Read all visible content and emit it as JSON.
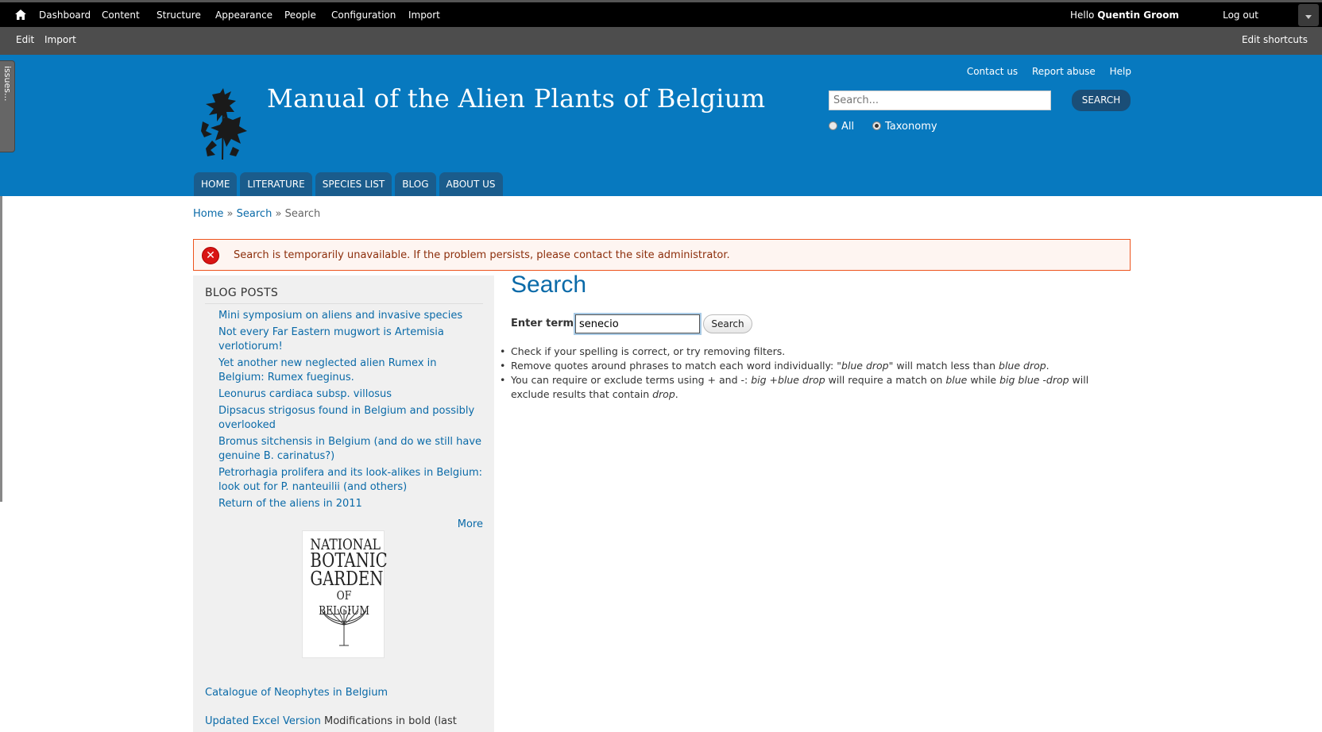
{
  "admin_toolbar": {
    "items": [
      "Dashboard",
      "Content",
      "Structure",
      "Appearance",
      "People",
      "Configuration",
      "Import"
    ],
    "greeting": "Hello",
    "username": "Quentin Groom",
    "logout": "Log out"
  },
  "shortcuts": {
    "items": [
      "Edit",
      "Import"
    ],
    "edit_shortcuts": "Edit shortcuts"
  },
  "side_tab": "issues...",
  "header": {
    "site_name": "Manual of the Alien Plants of Belgium",
    "secondary_links": [
      "Contact us",
      "Report abuse",
      "Help"
    ],
    "search_placeholder": "Search...",
    "search_button": "SEARCH",
    "radio_all": "All",
    "radio_taxonomy": "Taxonomy",
    "selected_radio": "Taxonomy"
  },
  "main_menu": [
    "HOME",
    "LITERATURE",
    "SPECIES LIST",
    "BLOG",
    "ABOUT US"
  ],
  "breadcrumb": {
    "home": "Home",
    "sep": "»",
    "search_link": "Search",
    "current": "Search"
  },
  "message": {
    "text": "Search is temporarily unavailable. If the problem persists, please contact the site administrator."
  },
  "sidebar": {
    "blog_title": "BLOG POSTS",
    "blog_posts": [
      "Mini symposium on aliens and invasive species",
      "Not every Far Eastern mugwort is Artemisia verlotiorum!",
      "Yet another new neglected alien Rumex in Belgium: Rumex fueginus.",
      "Leonurus cardiaca subsp. villosus",
      "Dipsacus strigosus found in Belgium and possibly overlooked",
      "Bromus sitchensis in Belgium (and do we still have genuine B. carinatus?)",
      "Petrorhagia prolifera and its look-alikes in Belgium: look out for P. nanteuilii (and others)",
      "Return of the aliens in 2011"
    ],
    "more": "More",
    "nbg_logo_lines": [
      "NATIONAL",
      "BOTANIC",
      "GARDEN",
      "OF BELGIUM"
    ],
    "catalogue_link": "Catalogue of Neophytes in Belgium",
    "excel_link": "Updated Excel Version",
    "excel_note": "Modifications in bold (last"
  },
  "main": {
    "title": "Search",
    "enter_terms_label": "Enter terms",
    "terms_value": "senecio",
    "search_button": "Search",
    "tip1": "Check if your spelling is correct, or try removing filters.",
    "tip2_a": "Remove quotes around phrases to match each word individually: ",
    "tip2_b": "\"blue drop\"",
    "tip2_c": " will match less than ",
    "tip2_d": "blue drop",
    "tip2_e": ".",
    "tip3_a": "You can require or exclude terms using + and -: ",
    "tip3_b": "big +blue drop",
    "tip3_c": " will require a match on ",
    "tip3_d": "blue",
    "tip3_e": " while ",
    "tip3_f": "big blue -drop",
    "tip3_g": " will exclude results that contain ",
    "tip3_h": "drop",
    "tip3_i": "."
  }
}
